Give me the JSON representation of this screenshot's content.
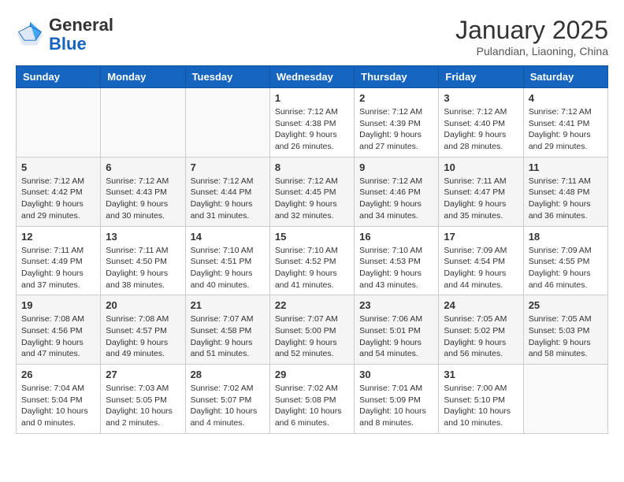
{
  "header": {
    "logo_general": "General",
    "logo_blue": "Blue",
    "month_title": "January 2025",
    "subtitle": "Pulandian, Liaoning, China"
  },
  "days_of_week": [
    "Sunday",
    "Monday",
    "Tuesday",
    "Wednesday",
    "Thursday",
    "Friday",
    "Saturday"
  ],
  "weeks": [
    [
      {
        "day": "",
        "info": ""
      },
      {
        "day": "",
        "info": ""
      },
      {
        "day": "",
        "info": ""
      },
      {
        "day": "1",
        "info": "Sunrise: 7:12 AM\nSunset: 4:38 PM\nDaylight: 9 hours\nand 26 minutes."
      },
      {
        "day": "2",
        "info": "Sunrise: 7:12 AM\nSunset: 4:39 PM\nDaylight: 9 hours\nand 27 minutes."
      },
      {
        "day": "3",
        "info": "Sunrise: 7:12 AM\nSunset: 4:40 PM\nDaylight: 9 hours\nand 28 minutes."
      },
      {
        "day": "4",
        "info": "Sunrise: 7:12 AM\nSunset: 4:41 PM\nDaylight: 9 hours\nand 29 minutes."
      }
    ],
    [
      {
        "day": "5",
        "info": "Sunrise: 7:12 AM\nSunset: 4:42 PM\nDaylight: 9 hours\nand 29 minutes."
      },
      {
        "day": "6",
        "info": "Sunrise: 7:12 AM\nSunset: 4:43 PM\nDaylight: 9 hours\nand 30 minutes."
      },
      {
        "day": "7",
        "info": "Sunrise: 7:12 AM\nSunset: 4:44 PM\nDaylight: 9 hours\nand 31 minutes."
      },
      {
        "day": "8",
        "info": "Sunrise: 7:12 AM\nSunset: 4:45 PM\nDaylight: 9 hours\nand 32 minutes."
      },
      {
        "day": "9",
        "info": "Sunrise: 7:12 AM\nSunset: 4:46 PM\nDaylight: 9 hours\nand 34 minutes."
      },
      {
        "day": "10",
        "info": "Sunrise: 7:11 AM\nSunset: 4:47 PM\nDaylight: 9 hours\nand 35 minutes."
      },
      {
        "day": "11",
        "info": "Sunrise: 7:11 AM\nSunset: 4:48 PM\nDaylight: 9 hours\nand 36 minutes."
      }
    ],
    [
      {
        "day": "12",
        "info": "Sunrise: 7:11 AM\nSunset: 4:49 PM\nDaylight: 9 hours\nand 37 minutes."
      },
      {
        "day": "13",
        "info": "Sunrise: 7:11 AM\nSunset: 4:50 PM\nDaylight: 9 hours\nand 38 minutes."
      },
      {
        "day": "14",
        "info": "Sunrise: 7:10 AM\nSunset: 4:51 PM\nDaylight: 9 hours\nand 40 minutes."
      },
      {
        "day": "15",
        "info": "Sunrise: 7:10 AM\nSunset: 4:52 PM\nDaylight: 9 hours\nand 41 minutes."
      },
      {
        "day": "16",
        "info": "Sunrise: 7:10 AM\nSunset: 4:53 PM\nDaylight: 9 hours\nand 43 minutes."
      },
      {
        "day": "17",
        "info": "Sunrise: 7:09 AM\nSunset: 4:54 PM\nDaylight: 9 hours\nand 44 minutes."
      },
      {
        "day": "18",
        "info": "Sunrise: 7:09 AM\nSunset: 4:55 PM\nDaylight: 9 hours\nand 46 minutes."
      }
    ],
    [
      {
        "day": "19",
        "info": "Sunrise: 7:08 AM\nSunset: 4:56 PM\nDaylight: 9 hours\nand 47 minutes."
      },
      {
        "day": "20",
        "info": "Sunrise: 7:08 AM\nSunset: 4:57 PM\nDaylight: 9 hours\nand 49 minutes."
      },
      {
        "day": "21",
        "info": "Sunrise: 7:07 AM\nSunset: 4:58 PM\nDaylight: 9 hours\nand 51 minutes."
      },
      {
        "day": "22",
        "info": "Sunrise: 7:07 AM\nSunset: 5:00 PM\nDaylight: 9 hours\nand 52 minutes."
      },
      {
        "day": "23",
        "info": "Sunrise: 7:06 AM\nSunset: 5:01 PM\nDaylight: 9 hours\nand 54 minutes."
      },
      {
        "day": "24",
        "info": "Sunrise: 7:05 AM\nSunset: 5:02 PM\nDaylight: 9 hours\nand 56 minutes."
      },
      {
        "day": "25",
        "info": "Sunrise: 7:05 AM\nSunset: 5:03 PM\nDaylight: 9 hours\nand 58 minutes."
      }
    ],
    [
      {
        "day": "26",
        "info": "Sunrise: 7:04 AM\nSunset: 5:04 PM\nDaylight: 10 hours\nand 0 minutes."
      },
      {
        "day": "27",
        "info": "Sunrise: 7:03 AM\nSunset: 5:05 PM\nDaylight: 10 hours\nand 2 minutes."
      },
      {
        "day": "28",
        "info": "Sunrise: 7:02 AM\nSunset: 5:07 PM\nDaylight: 10 hours\nand 4 minutes."
      },
      {
        "day": "29",
        "info": "Sunrise: 7:02 AM\nSunset: 5:08 PM\nDaylight: 10 hours\nand 6 minutes."
      },
      {
        "day": "30",
        "info": "Sunrise: 7:01 AM\nSunset: 5:09 PM\nDaylight: 10 hours\nand 8 minutes."
      },
      {
        "day": "31",
        "info": "Sunrise: 7:00 AM\nSunset: 5:10 PM\nDaylight: 10 hours\nand 10 minutes."
      },
      {
        "day": "",
        "info": ""
      }
    ]
  ]
}
